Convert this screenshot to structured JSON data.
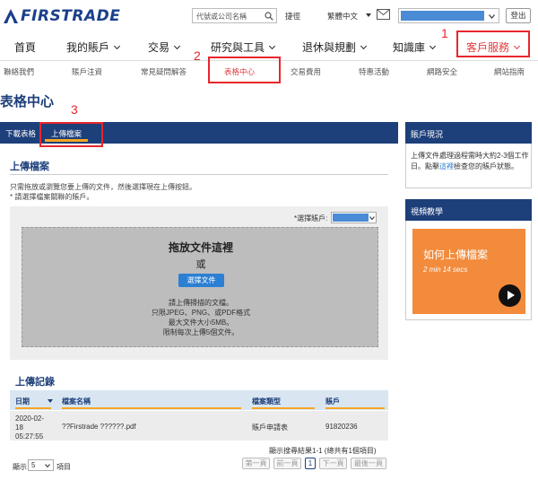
{
  "header": {
    "logo_text": "FIRSTRADE",
    "search_placeholder": "代號或公司名稱",
    "links": [
      "捷徑",
      "繁體中文"
    ],
    "logout_label": "登出"
  },
  "main_nav": [
    {
      "label": "首頁",
      "has_caret": false
    },
    {
      "label": "我的賬戶",
      "has_caret": true
    },
    {
      "label": "交易",
      "has_caret": true
    },
    {
      "label": "研究與工具",
      "has_caret": true
    },
    {
      "label": "退休與規劃",
      "has_caret": true
    },
    {
      "label": "知識庫",
      "has_caret": true
    },
    {
      "label": "客戶服務",
      "has_caret": true,
      "active": true
    }
  ],
  "sub_nav": [
    "聯絡我們",
    "賬戶注資",
    "常見疑問解答",
    "表格中心",
    "交易費用",
    "特惠活動",
    "網路安全",
    "網站指南"
  ],
  "annotations": [
    "1",
    "2",
    "3"
  ],
  "page_title": "表格中心",
  "tabs": [
    "下載表格",
    "上傳檔案"
  ],
  "upload": {
    "section_title": "上傳檔案",
    "help_line1": "只需拖放或瀏覽您要上傳的文件，然後選擇現在上傳按鈕。",
    "help_line2": "* 請選擇檔案關聯的賬戶。",
    "account_label": "*選擇賬戶:",
    "drop_title": "拖放文件這裡",
    "drop_or": "或",
    "choose_button": "選擇文件",
    "notes": [
      "請上傳掃描的文檔。",
      "只限JPEG、PNG、或PDF格式",
      "最大文件大小5MB。",
      "限制每次上傳5個文件。"
    ]
  },
  "records": {
    "section_title": "上傳記錄",
    "columns": [
      "日期",
      "檔案名稱",
      "檔案類型",
      "賬戶"
    ],
    "rows": [
      {
        "date_lines": [
          "2020-02-",
          "18",
          "05:27:55"
        ],
        "file_name": "??Firstrade ??????.pdf",
        "file_type": "賬戶申請表",
        "account": "91820236"
      }
    ],
    "result_text": "顯示搜尋結果1-1 (總共有1個項目)",
    "show_label": "顯示",
    "show_value": "5",
    "items_label": "項目",
    "pagination": [
      "第一頁",
      "前一頁",
      "1",
      "下一頁",
      "最後一頁"
    ]
  },
  "sidebar": {
    "status_title": "賬戶現況",
    "status_text_before": "上傳文件處理過程需時大約2-3個工作日。點擊",
    "status_link": "這裡",
    "status_text_after": "檢查您的賬戶狀態。",
    "video_section_title": "視頻教學",
    "video_title": "如何上傳檔案",
    "video_duration": "2 min 14 secs"
  },
  "colors": {
    "brand_navy": "#1d3f7a",
    "accent_orange": "#f5a623",
    "highlight_red": "#e8262c",
    "video_orange": "#f28b3c"
  }
}
